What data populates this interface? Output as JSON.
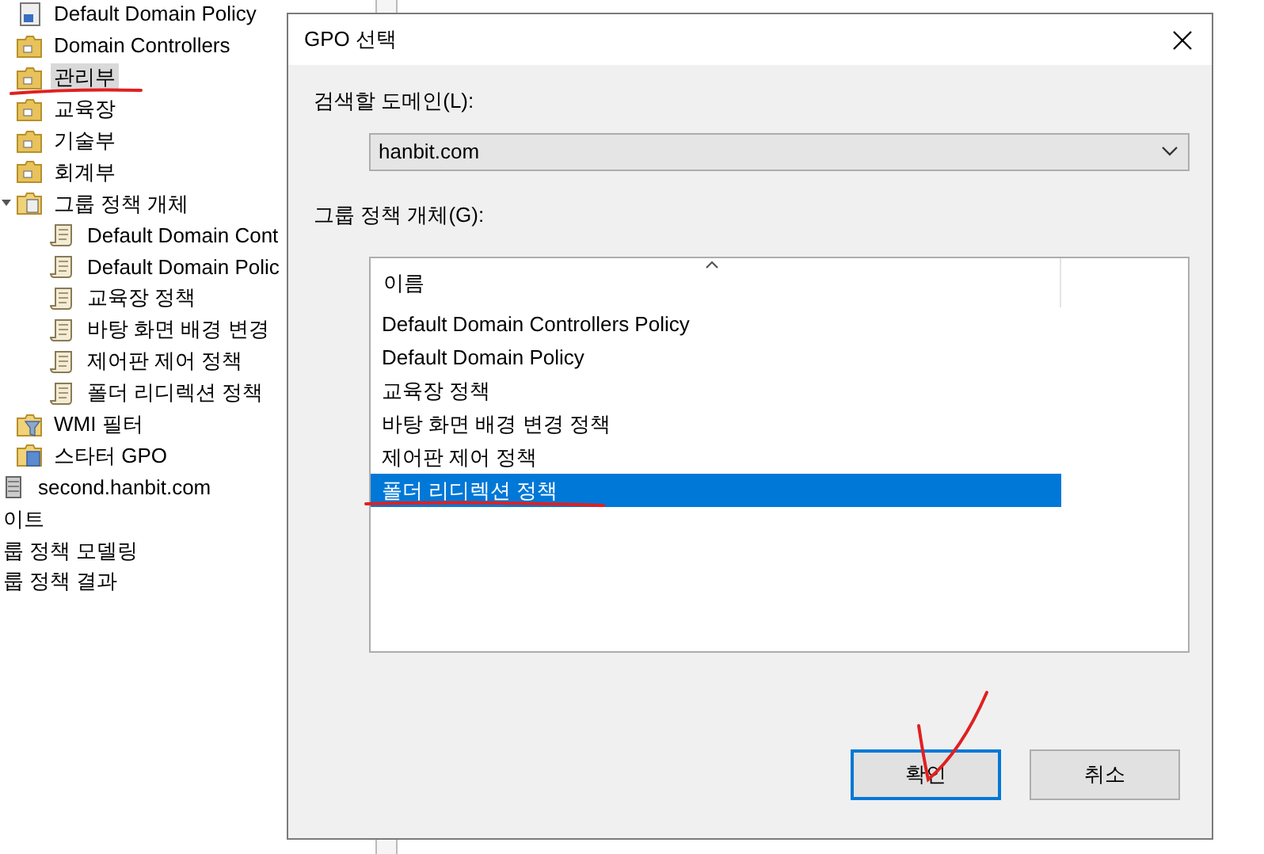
{
  "tree": {
    "domain_items": [
      {
        "label": "Default Domain Policy",
        "kind": "gpo-link",
        "selected": false
      },
      {
        "label": "Domain Controllers",
        "kind": "ou",
        "selected": false
      },
      {
        "label": "관리부",
        "kind": "ou",
        "selected": true
      },
      {
        "label": "교육장",
        "kind": "ou",
        "selected": false
      },
      {
        "label": "기술부",
        "kind": "ou",
        "selected": false
      },
      {
        "label": "회계부",
        "kind": "ou",
        "selected": false
      },
      {
        "label": "그룹 정책 개체",
        "kind": "gpo-folder",
        "selected": false,
        "expanded": true,
        "children": [
          {
            "label": "Default Domain Cont",
            "kind": "gpo",
            "selected": false
          },
          {
            "label": "Default Domain Polic",
            "kind": "gpo",
            "selected": false
          },
          {
            "label": "교육장 정책",
            "kind": "gpo",
            "selected": false
          },
          {
            "label": "바탕 화면 배경 변경",
            "kind": "gpo",
            "selected": false
          },
          {
            "label": "제어판 제어 정책",
            "kind": "gpo",
            "selected": false
          },
          {
            "label": "폴더 리디렉션 정책",
            "kind": "gpo",
            "selected": false
          }
        ]
      },
      {
        "label": "WMI 필터",
        "kind": "wmi",
        "selected": false
      },
      {
        "label": "스타터 GPO",
        "kind": "starter",
        "selected": false
      }
    ],
    "domain": {
      "label": "second.hanbit.com"
    },
    "root_items": [
      {
        "label": "이트"
      },
      {
        "label": "룹 정책 모델링"
      },
      {
        "label": "룹 정책 결과"
      }
    ]
  },
  "dialog": {
    "title": "GPO 선택",
    "domain_label": "검색할 도메인(L):",
    "domain_value": "hanbit.com",
    "gpo_label": "그룹 정책 개체(G):",
    "list": {
      "column": "이름",
      "rows": [
        {
          "label": "Default Domain Controllers Policy",
          "selected": false
        },
        {
          "label": "Default Domain Policy",
          "selected": false
        },
        {
          "label": "교육장 정책",
          "selected": false
        },
        {
          "label": "바탕 화면 배경 변경 정책",
          "selected": false
        },
        {
          "label": "제어판 제어 정책",
          "selected": false
        },
        {
          "label": "폴더 리디렉션 정책",
          "selected": true
        }
      ]
    },
    "buttons": [
      {
        "label": "확인",
        "default": true
      },
      {
        "label": "취소",
        "default": false
      }
    ]
  }
}
